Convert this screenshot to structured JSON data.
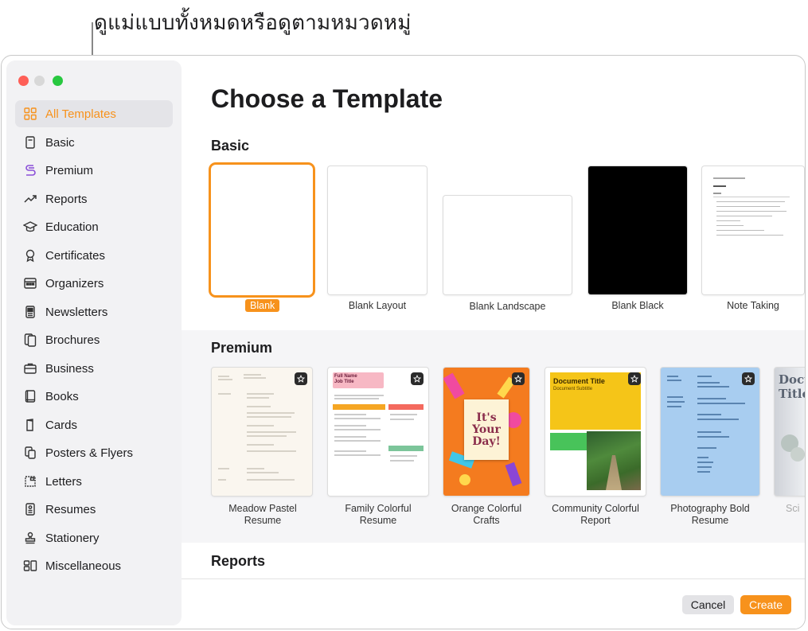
{
  "callout": {
    "text": "ดูแม่แบบทั้งหมดหรือดูตามหมวดหมู่"
  },
  "window": {
    "title": "Choose a Template"
  },
  "sidebar": {
    "items": [
      {
        "label": "All Templates",
        "icon": "grid-icon",
        "selected": true
      },
      {
        "label": "Basic",
        "icon": "document-icon"
      },
      {
        "label": "Premium",
        "icon": "premium-icon"
      },
      {
        "label": "Reports",
        "icon": "chart-line-icon"
      },
      {
        "label": "Education",
        "icon": "graduation-cap-icon"
      },
      {
        "label": "Certificates",
        "icon": "ribbon-icon"
      },
      {
        "label": "Organizers",
        "icon": "calendar-icon"
      },
      {
        "label": "Newsletters",
        "icon": "newsletter-icon"
      },
      {
        "label": "Brochures",
        "icon": "brochure-icon"
      },
      {
        "label": "Business",
        "icon": "briefcase-icon"
      },
      {
        "label": "Books",
        "icon": "book-icon"
      },
      {
        "label": "Cards",
        "icon": "card-icon"
      },
      {
        "label": "Posters & Flyers",
        "icon": "poster-icon"
      },
      {
        "label": "Letters",
        "icon": "letter-icon"
      },
      {
        "label": "Resumes",
        "icon": "resume-icon"
      },
      {
        "label": "Stationery",
        "icon": "stamp-icon"
      },
      {
        "label": "Miscellaneous",
        "icon": "misc-icon"
      }
    ]
  },
  "sections": {
    "basic": {
      "title": "Basic",
      "templates": [
        {
          "label": "Blank",
          "selected": true
        },
        {
          "label": "Blank Layout"
        },
        {
          "label": "Blank Landscape"
        },
        {
          "label": "Blank Black"
        },
        {
          "label": "Note Taking"
        }
      ]
    },
    "premium": {
      "title": "Premium",
      "templates": [
        {
          "label_line1": "Meadow Pastel",
          "label_line2": "Resume"
        },
        {
          "label_line1": "Family Colorful",
          "label_line2": "Resume"
        },
        {
          "label_line1": "Orange Colorful",
          "label_line2": "Crafts"
        },
        {
          "label_line1": "Community Colorful",
          "label_line2": "Report"
        },
        {
          "label_line1": "Photography Bold",
          "label_line2": "Resume"
        },
        {
          "label_line1": "Sci",
          "label_line2": ""
        }
      ]
    },
    "reports": {
      "title": "Reports"
    }
  },
  "thumbs": {
    "family": {
      "title_line1": "Full Name",
      "title_line2": "Job Title"
    },
    "crafts": {
      "line1": "It's",
      "line2": "Your",
      "line3": "Day!"
    },
    "community": {
      "title": "Document Title",
      "subtitle": "Document Subtitle"
    },
    "sci": {
      "title_line1": "Docu",
      "title_line2": "Title"
    }
  },
  "footer": {
    "cancel": "Cancel",
    "create": "Create"
  },
  "colors": {
    "accent": "#f7921c",
    "sidebar_bg": "#f2f2f4",
    "band_bg": "#f5f5f7"
  }
}
